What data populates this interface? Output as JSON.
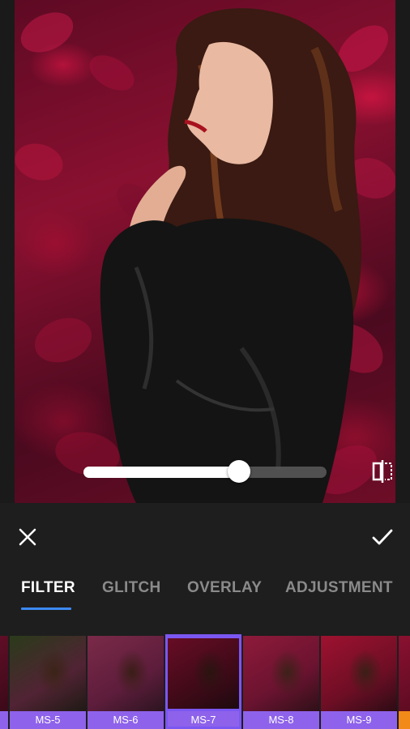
{
  "editor": {
    "slider_value_percent": 64
  },
  "actions": {
    "close_icon": "close-icon",
    "confirm_icon": "checkmark-icon",
    "compare_icon": "compare-icon"
  },
  "tabs": [
    {
      "label": "FILTER",
      "active": true
    },
    {
      "label": "GLITCH",
      "active": false
    },
    {
      "label": "OVERLAY",
      "active": false
    },
    {
      "label": "ADJUSTMENT",
      "active": false
    }
  ],
  "filters": [
    {
      "label": "MS-5",
      "selected": false
    },
    {
      "label": "MS-6",
      "selected": false
    },
    {
      "label": "MS-7",
      "selected": true
    },
    {
      "label": "MS-8",
      "selected": false
    },
    {
      "label": "MS-9",
      "selected": false
    }
  ],
  "colors": {
    "accent_blue": "#3d8af7",
    "filter_label_bg": "#8e62ea",
    "selection_border": "#7b57f2",
    "panel_bg": "#1e1e1e"
  }
}
